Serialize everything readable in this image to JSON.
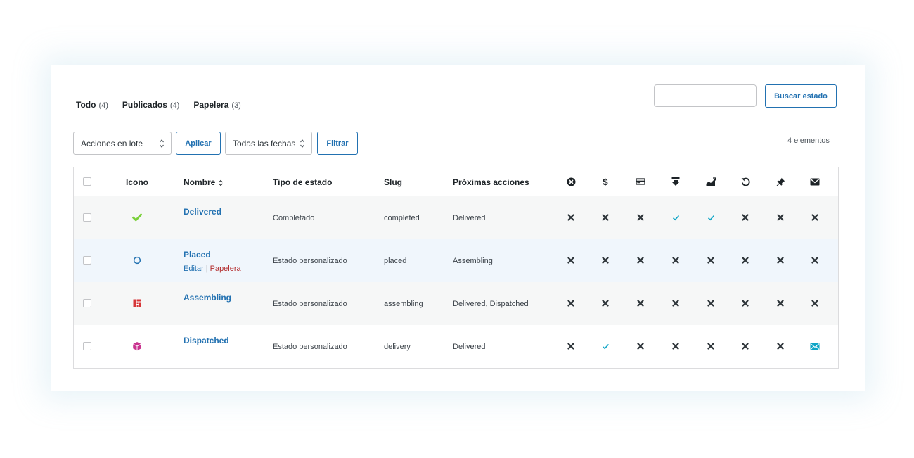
{
  "tabs": [
    {
      "label": "Todo",
      "count": "(4)"
    },
    {
      "label": "Publicados",
      "count": "(4)"
    },
    {
      "label": "Papelera",
      "count": "(3)"
    }
  ],
  "search": {
    "value": "",
    "placeholder": "",
    "button_label": "Buscar estado"
  },
  "toolbar": {
    "bulk_actions": "Acciones en lote",
    "apply_label": "Aplicar",
    "dates": "Todas las fechas",
    "filter_label": "Filtrar",
    "item_count": "4 elementos"
  },
  "table": {
    "headers": {
      "icon": "Icono",
      "name": "Nombre",
      "type": "Tipo de estado",
      "slug": "Slug",
      "next": "Próximas acciones"
    },
    "flag_columns": [
      "cancel-icon",
      "dollar-icon",
      "credit-card-icon",
      "download-icon",
      "chart-icon",
      "undo-icon",
      "pin-icon",
      "email-icon"
    ],
    "rows": [
      {
        "name": "Delivered",
        "type": "Completado",
        "slug": "completed",
        "next": "Delivered",
        "icon": "checkmark-icon",
        "icon_color": "#7ad03a",
        "flags": [
          "no",
          "no",
          "no",
          "yes",
          "yes",
          "no",
          "no",
          "no"
        ]
      },
      {
        "name": "Placed",
        "type": "Estado personalizado",
        "slug": "placed",
        "next": "Assembling",
        "icon": "circle-icon",
        "icon_color": "#2271b1",
        "flags": [
          "no",
          "no",
          "no",
          "no",
          "no",
          "no",
          "no",
          "no"
        ],
        "actions": {
          "edit": "Editar",
          "separator": "|",
          "trash": "Papelera"
        }
      },
      {
        "name": "Assembling",
        "type": "Estado personalizado",
        "slug": "assembling",
        "next": "Delivered, Dispatched",
        "icon": "layout-icon",
        "icon_color": "#d63638",
        "flags": [
          "no",
          "no",
          "no",
          "no",
          "no",
          "no",
          "no",
          "no"
        ]
      },
      {
        "name": "Dispatched",
        "type": "Estado personalizado",
        "slug": "delivery",
        "next": "Delivered",
        "icon": "box-icon",
        "icon_color": "#c9338f",
        "flags": [
          "no",
          "yes",
          "no",
          "no",
          "no",
          "no",
          "no",
          "email"
        ]
      }
    ]
  },
  "colors": {
    "accent": "#2271b1",
    "check": "#0ea5c6",
    "cross": "#2c3338",
    "danger": "#b32d2e"
  }
}
